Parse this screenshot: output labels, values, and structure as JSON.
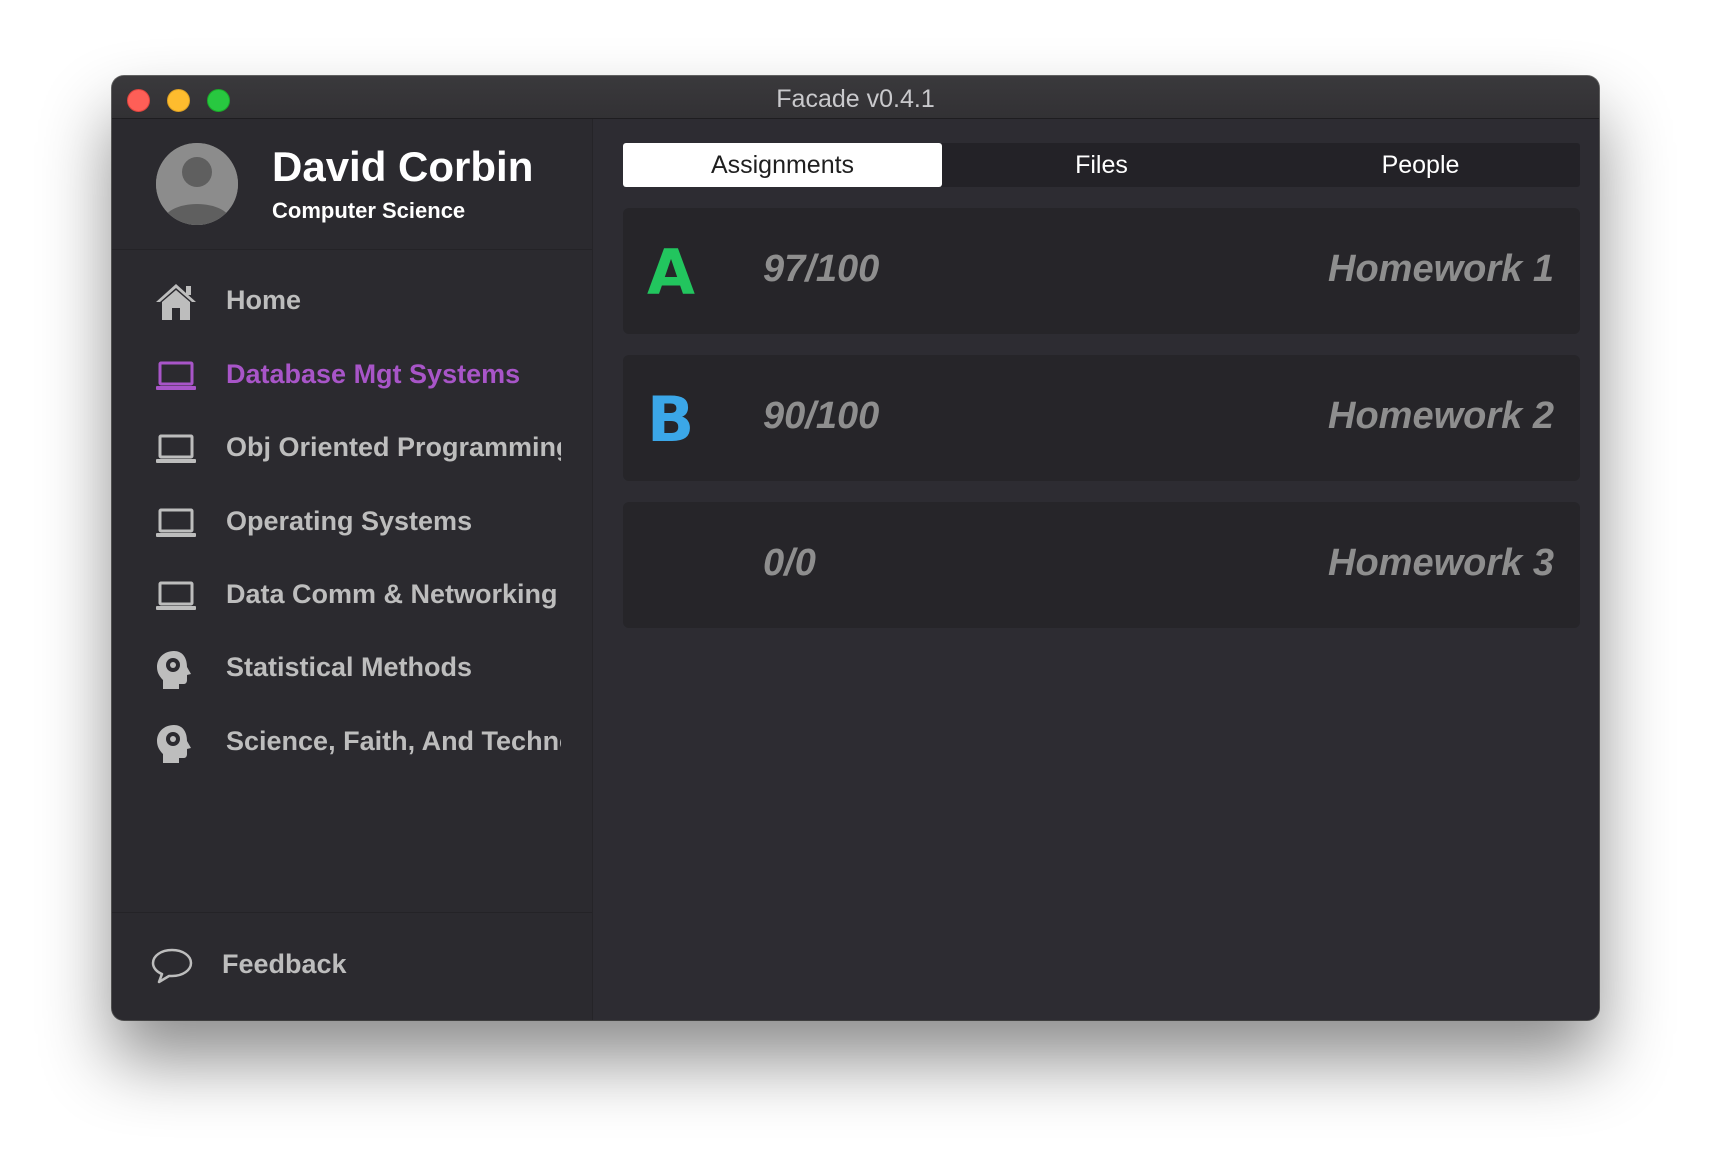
{
  "window": {
    "title": "Facade v0.4.1"
  },
  "profile": {
    "name": "David Corbin",
    "department": "Computer Science"
  },
  "sidebar": {
    "items": [
      {
        "label": "Home",
        "icon": "home-icon",
        "active": false
      },
      {
        "label": "Database Mgt Systems",
        "icon": "laptop-icon",
        "active": true
      },
      {
        "label": "Obj Oriented  Programming",
        "icon": "laptop-icon",
        "active": false
      },
      {
        "label": "Operating Systems",
        "icon": "laptop-icon",
        "active": false
      },
      {
        "label": "Data Comm & Networking",
        "icon": "laptop-icon",
        "active": false
      },
      {
        "label": "Statistical Methods",
        "icon": "head-icon",
        "active": false
      },
      {
        "label": "Science, Faith, And Technology",
        "icon": "head-icon",
        "active": false
      }
    ],
    "feedback": {
      "label": "Feedback",
      "icon": "speech-bubble-icon"
    }
  },
  "tabs": [
    {
      "label": "Assignments",
      "active": true
    },
    {
      "label": "Files",
      "active": false
    },
    {
      "label": "People",
      "active": false
    }
  ],
  "assignments": [
    {
      "grade": "A",
      "grade_color": "#22c55e",
      "score": "97/100",
      "name": "Homework 1"
    },
    {
      "grade": "B",
      "grade_color": "#3ba7e8",
      "score": "90/100",
      "name": "Homework 2"
    },
    {
      "grade": "",
      "grade_color": "#8e8e8e",
      "score": "0/0",
      "name": "Homework 3"
    }
  ],
  "colors": {
    "accent": "#a855c8",
    "background": "#2d2c32",
    "sidebar": "#2b2a2f",
    "card": "#262529"
  }
}
